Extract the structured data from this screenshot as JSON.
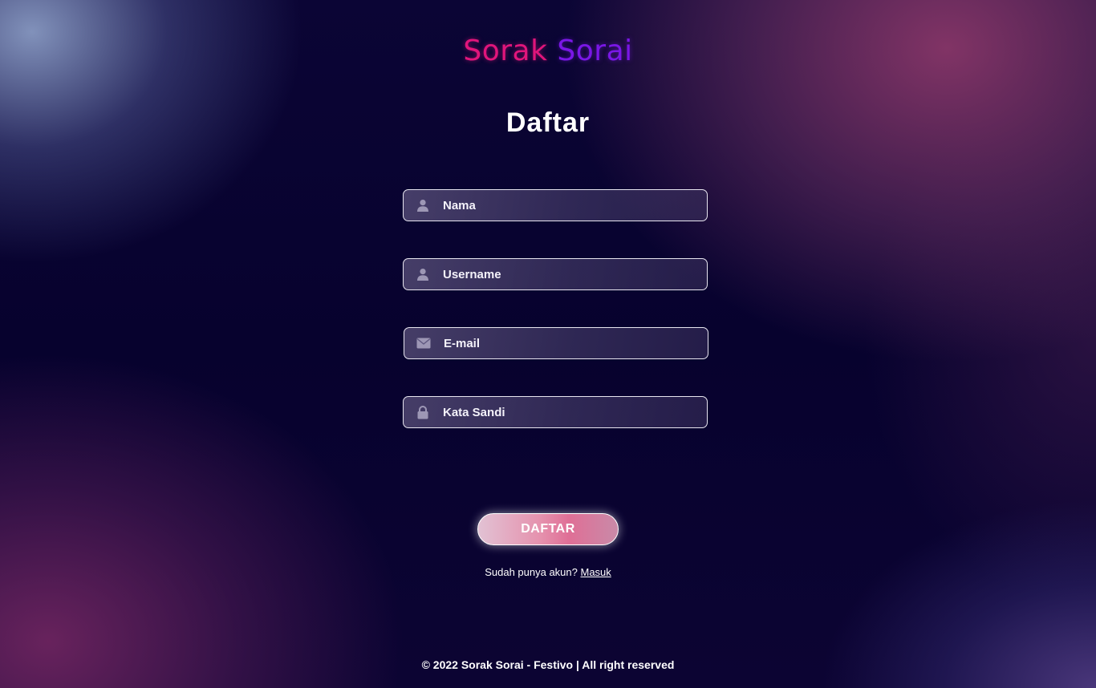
{
  "brand": {
    "name_part1": "Sorak",
    "name_part2": "Sorai",
    "color_part1": "#e0157b",
    "color_part2": "#7a17e6"
  },
  "form": {
    "title": "Daftar",
    "fields": [
      {
        "icon": "user-icon",
        "placeholder": "Nama",
        "value": ""
      },
      {
        "icon": "user-icon",
        "placeholder": "Username",
        "value": ""
      },
      {
        "icon": "envelope-icon",
        "placeholder": "E-mail",
        "value": ""
      },
      {
        "icon": "lock-icon",
        "placeholder": "Kata Sandi",
        "value": ""
      }
    ],
    "submit_label": "DAFTAR"
  },
  "signin_prompt": {
    "text": "Sudah punya akun?",
    "link_label": "Masuk"
  },
  "footer": {
    "text": "© 2022 Sorak Sorai - Festivo | All right reserved"
  },
  "colors": {
    "background": "#0a0430",
    "button_accent": "#df6f96",
    "field_border": "#e8e6f0"
  }
}
